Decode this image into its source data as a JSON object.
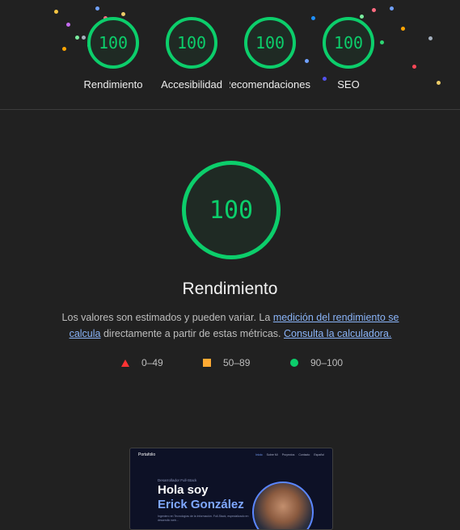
{
  "top_gauges": [
    {
      "score": "100",
      "label": "Rendimiento"
    },
    {
      "score": "100",
      "label": "Accesibilidad"
    },
    {
      "score": "100",
      "label": "Recomendaciones"
    },
    {
      "score": "100",
      "label": "SEO"
    }
  ],
  "main": {
    "score": "100",
    "title": "Rendimiento",
    "desc_part1": "Los valores son estimados y pueden variar. La ",
    "desc_link1": "medición del rendimiento se calcula",
    "desc_part2": " directamente a partir de estas métricas. ",
    "desc_link2": "Consulta la calculadora."
  },
  "legend": [
    {
      "range": "0–49",
      "shape": "triangle",
      "color": "#ff3333"
    },
    {
      "range": "50–89",
      "shape": "square",
      "color": "#ffaa33"
    },
    {
      "range": "90–100",
      "shape": "circle",
      "color": "#0cce6b"
    }
  ],
  "screenshot": {
    "logo": "Portafolio",
    "nav": [
      "Inicio",
      "Sobre Mí",
      "Proyectos",
      "Contacto",
      "Español"
    ],
    "subtitle": "Desarrollador Full-Stack",
    "heading_line1": "Hola soy",
    "heading_line2": "Erick González",
    "blurb": "Ingeniero en Tecnologías de la Información. Full-Stack, especializado en desarrollo web..."
  }
}
